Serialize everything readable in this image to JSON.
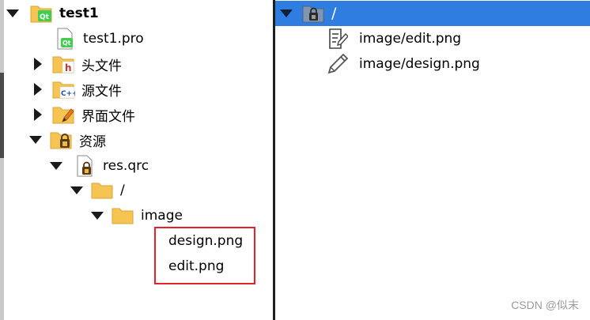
{
  "project_tree": {
    "project_name": "test1",
    "pro_file": "test1.pro",
    "headers_label": "头文件",
    "sources_label": "源文件",
    "forms_label": "界面文件",
    "resources_label": "资源",
    "qrc_file": "res.qrc",
    "prefix": "/",
    "folder": "image",
    "files": [
      "design.png",
      "edit.png"
    ]
  },
  "resource_view": {
    "prefix": "/",
    "items": [
      "image/edit.png",
      "image/design.png"
    ]
  },
  "watermark": "CSDN @似末",
  "colors": {
    "selection": "#2f7de1",
    "highlight_box": "#e0242c",
    "qt_green": "#41cd52",
    "folder_yellow": "#f6c453"
  }
}
